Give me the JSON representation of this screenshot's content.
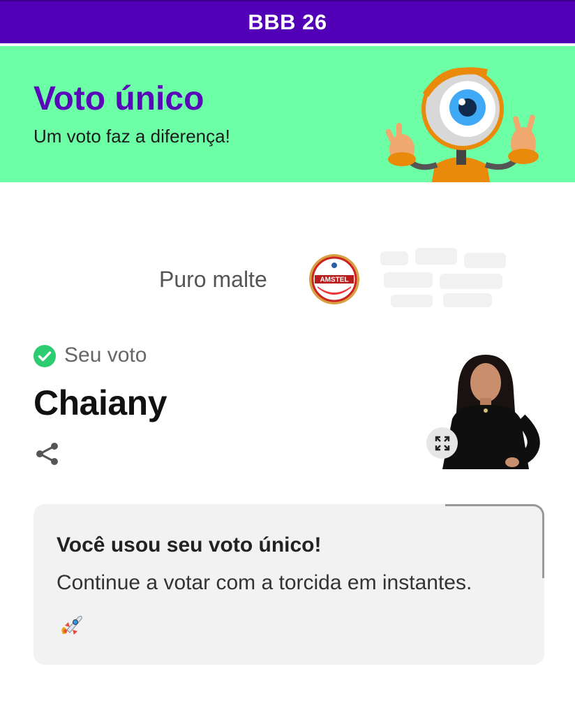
{
  "header": {
    "title": "BBB 26"
  },
  "banner": {
    "title": "Voto único",
    "subtitle": "Um voto faz a diferença!",
    "mascot_icon": "big-brother-eye-mascot",
    "background_color": "#6dffa6",
    "title_color": "#5a07b9"
  },
  "sponsor": {
    "text": "Puro malte",
    "logo_icon": "amstel-logo",
    "logo_text": "AMSTEL"
  },
  "vote": {
    "status_label": "Seu voto",
    "status_icon": "check-circle-icon",
    "candidate_name": "Chaiany",
    "share_icon": "share-icon",
    "expand_icon": "expand-icon"
  },
  "notice": {
    "title": "Você usou seu voto único!",
    "message": "Continue a votar com a torcida em instantes.",
    "emoji_icon": "rocket-icon"
  },
  "colors": {
    "top_bar": "#5200b8",
    "check": "#2ecc71",
    "card_bg": "#f2f2f2"
  }
}
